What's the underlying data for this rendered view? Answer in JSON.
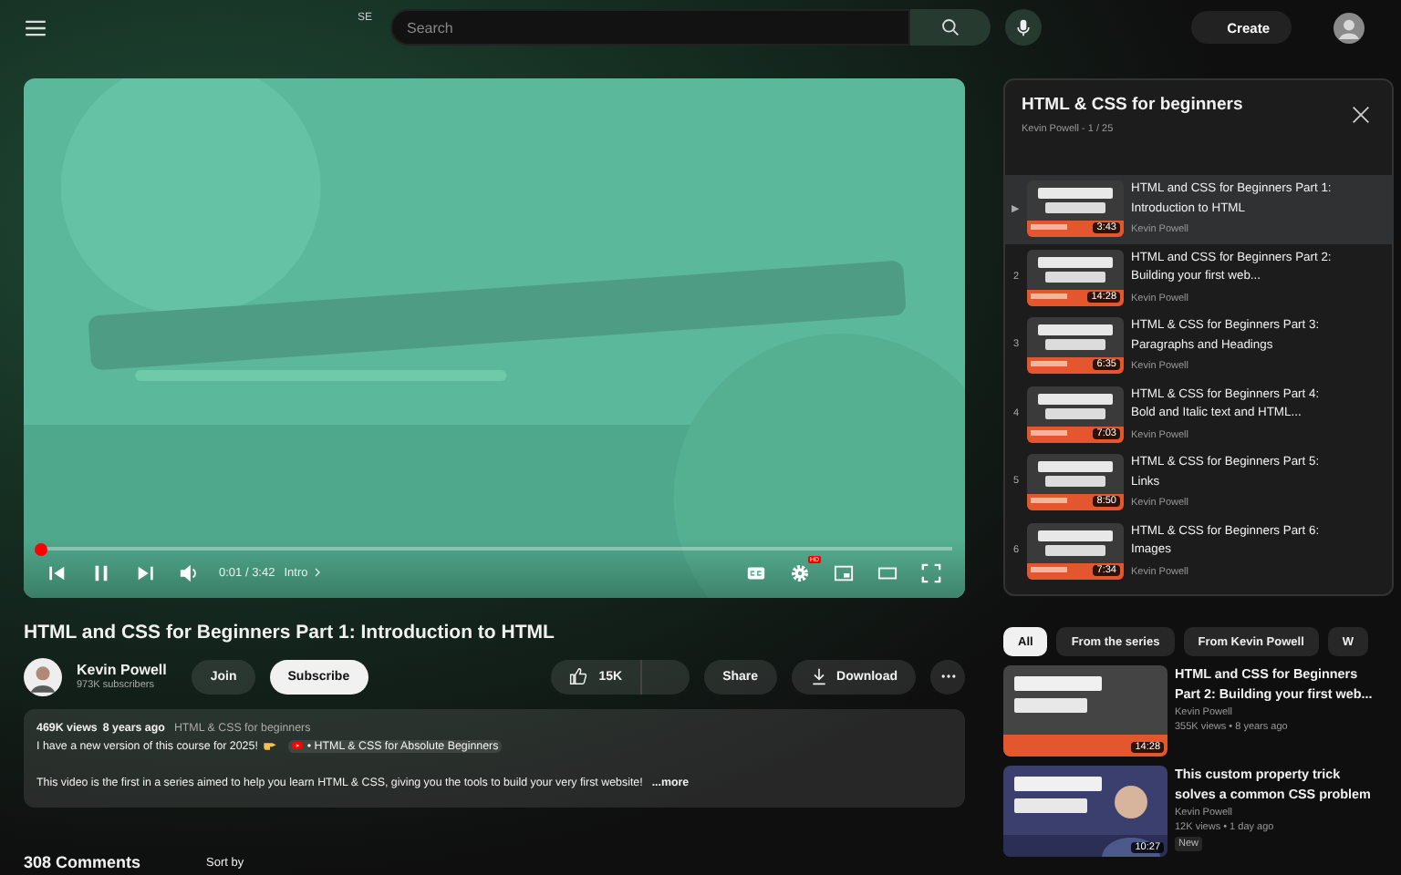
{
  "topbar": {
    "logo_text": "SE",
    "search": {
      "placeholder": "Search"
    },
    "create_label": "Create"
  },
  "player": {
    "progress": {
      "level": 0.005
    },
    "time": "0:01 / 3:42",
    "chapter": "Intro",
    "settings_badge": "HD"
  },
  "video": {
    "title": "HTML and CSS for Beginners Part 1: Introduction to HTML",
    "channel": {
      "name": "Kevin Powell",
      "subscribers": "973K subscribers"
    },
    "join": "Join",
    "subscribe": "Subscribe",
    "likes": "15K",
    "share": "Share",
    "download": "Download"
  },
  "description": {
    "views": "469K views",
    "age": "8 years ago",
    "playlist_link": "HTML & CSS for beginners",
    "line1": "I have a new version of this course for 2025!",
    "chip_link": "• HTML & CSS for Absolute Beginners",
    "line2": "This video is the first in a series aimed to help you learn HTML & CSS, giving you the tools to build your very first website!",
    "more": "...more"
  },
  "comments": {
    "count": "308 Comments",
    "sort": "Sort by"
  },
  "playlist": {
    "title": "HTML & CSS for beginners",
    "meta": "Kevin Powell - 1 / 25",
    "items": [
      {
        "index": "▶",
        "title": "HTML and CSS for Beginners Part 1: Introduction to HTML",
        "channel": "Kevin Powell",
        "duration": "3:43",
        "selected": true
      },
      {
        "index": "2",
        "title": "HTML and CSS for Beginners Part 2: Building your first web...",
        "channel": "Kevin Powell",
        "duration": "14:28",
        "selected": false
      },
      {
        "index": "3",
        "title": "HTML & CSS for Beginners Part 3: Paragraphs and Headings",
        "channel": "Kevin Powell",
        "duration": "6:35",
        "selected": false
      },
      {
        "index": "4",
        "title": "HTML & CSS for Beginners Part 4: Bold and Italic text and HTML...",
        "channel": "Kevin Powell",
        "duration": "7:03",
        "selected": false
      },
      {
        "index": "5",
        "title": "HTML & CSS for Beginners Part 5: Links",
        "channel": "Kevin Powell",
        "duration": "8:50",
        "selected": false
      },
      {
        "index": "6",
        "title": "HTML & CSS for Beginners Part 6: Images",
        "channel": "Kevin Powell",
        "duration": "7:34",
        "selected": false
      }
    ]
  },
  "chips": [
    {
      "label": "All",
      "selected": true
    },
    {
      "label": "From the series",
      "selected": false
    },
    {
      "label": "From Kevin Powell",
      "selected": false
    },
    {
      "label": "W",
      "selected": false
    }
  ],
  "related": [
    {
      "title": "HTML and CSS for Beginners Part 2: Building your first web...",
      "channel": "Kevin Powell",
      "meta": "355K views • 8 years ago",
      "duration": "14:28"
    },
    {
      "title": "This custom property trick solves a common CSS problem",
      "channel": "Kevin Powell",
      "meta": "12K views • 1 day ago",
      "duration": "10:27",
      "badge": "New"
    }
  ]
}
